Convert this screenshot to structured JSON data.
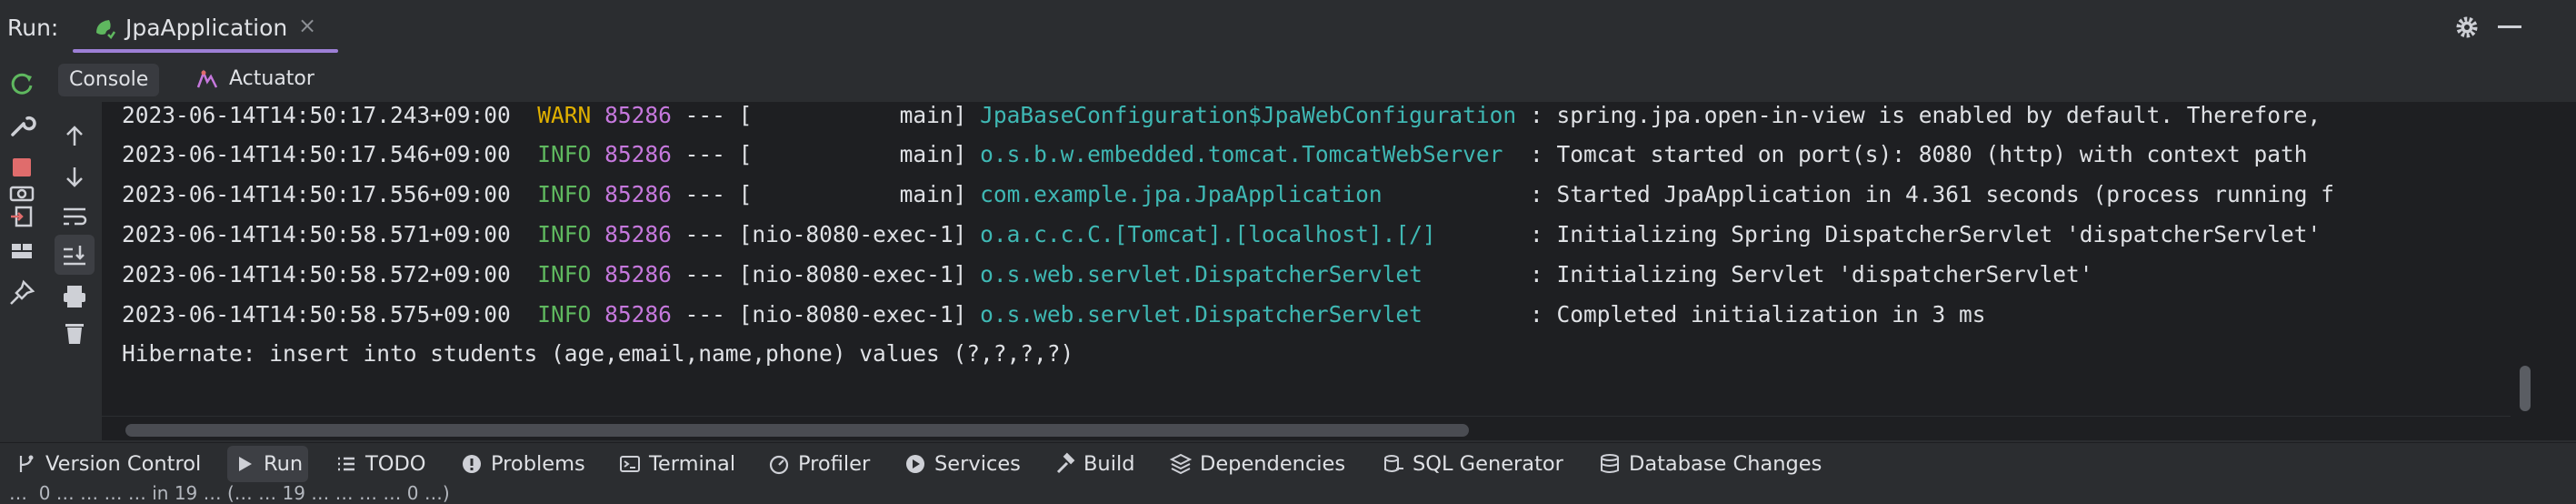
{
  "run_panel": {
    "label": "Run:",
    "tab_title": "JpaApplication",
    "tab_close": "×"
  },
  "console_tabs": [
    {
      "label": "Console"
    },
    {
      "label": "Actuator"
    }
  ],
  "log_lines": [
    {
      "ts": "2023-06-14T14:50:17.243+09:00",
      "level": "WARN",
      "pid": "85286",
      "sep": "---",
      "thread": "[           main]",
      "logger": "JpaBaseConfiguration$JpaWebConfiguration",
      "msg": ": spring.jpa.open-in-view is enabled by default. Therefore,"
    },
    {
      "ts": "2023-06-14T14:50:17.546+09:00",
      "level": "INFO",
      "pid": "85286",
      "sep": "---",
      "thread": "[           main]",
      "logger": "o.s.b.w.embedded.tomcat.TomcatWebServer",
      "msg": ": Tomcat started on port(s): 8080 (http) with context path"
    },
    {
      "ts": "2023-06-14T14:50:17.556+09:00",
      "level": "INFO",
      "pid": "85286",
      "sep": "---",
      "thread": "[           main]",
      "logger": "com.example.jpa.JpaApplication",
      "msg": ": Started JpaApplication in 4.361 seconds (process running f"
    },
    {
      "ts": "2023-06-14T14:50:58.571+09:00",
      "level": "INFO",
      "pid": "85286",
      "sep": "---",
      "thread": "[nio-8080-exec-1]",
      "logger": "o.a.c.c.C.[Tomcat].[localhost].[/]",
      "msg": ": Initializing Spring DispatcherServlet 'dispatcherServlet'"
    },
    {
      "ts": "2023-06-14T14:50:58.572+09:00",
      "level": "INFO",
      "pid": "85286",
      "sep": "---",
      "thread": "[nio-8080-exec-1]",
      "logger": "o.s.web.servlet.DispatcherServlet",
      "msg": ": Initializing Servlet 'dispatcherServlet'"
    },
    {
      "ts": "2023-06-14T14:50:58.575+09:00",
      "level": "INFO",
      "pid": "85286",
      "sep": "---",
      "thread": "[nio-8080-exec-1]",
      "logger": "o.s.web.servlet.DispatcherServlet",
      "msg": ": Completed initialization in 3 ms"
    }
  ],
  "hibernate_line": "Hibernate: insert into students (age,email,name,phone) values (?,?,?,?)",
  "bottom_tabs": [
    {
      "label": "Version Control",
      "icon": "branch-icon"
    },
    {
      "label": "Run",
      "icon": "play-icon"
    },
    {
      "label": "TODO",
      "icon": "list-icon"
    },
    {
      "label": "Problems",
      "icon": "alert-icon"
    },
    {
      "label": "Terminal",
      "icon": "terminal-icon"
    },
    {
      "label": "Profiler",
      "icon": "profiler-icon"
    },
    {
      "label": "Services",
      "icon": "services-icon"
    },
    {
      "label": "Build",
      "icon": "hammer-icon"
    },
    {
      "label": "Dependencies",
      "icon": "dependencies-icon"
    },
    {
      "label": "SQL Generator",
      "icon": "sql-generator-icon"
    },
    {
      "label": "Database Changes",
      "icon": "database-icon"
    }
  ],
  "status": {
    "text": "…  0 … … … … in 19 … (… … 19 … … … … 0 …)"
  },
  "colors": {
    "warn": "#e0b000",
    "info": "#5fb85f",
    "pid": "#c678dd",
    "logger": "#3fb8b4",
    "accent": "#9d7fd6"
  }
}
